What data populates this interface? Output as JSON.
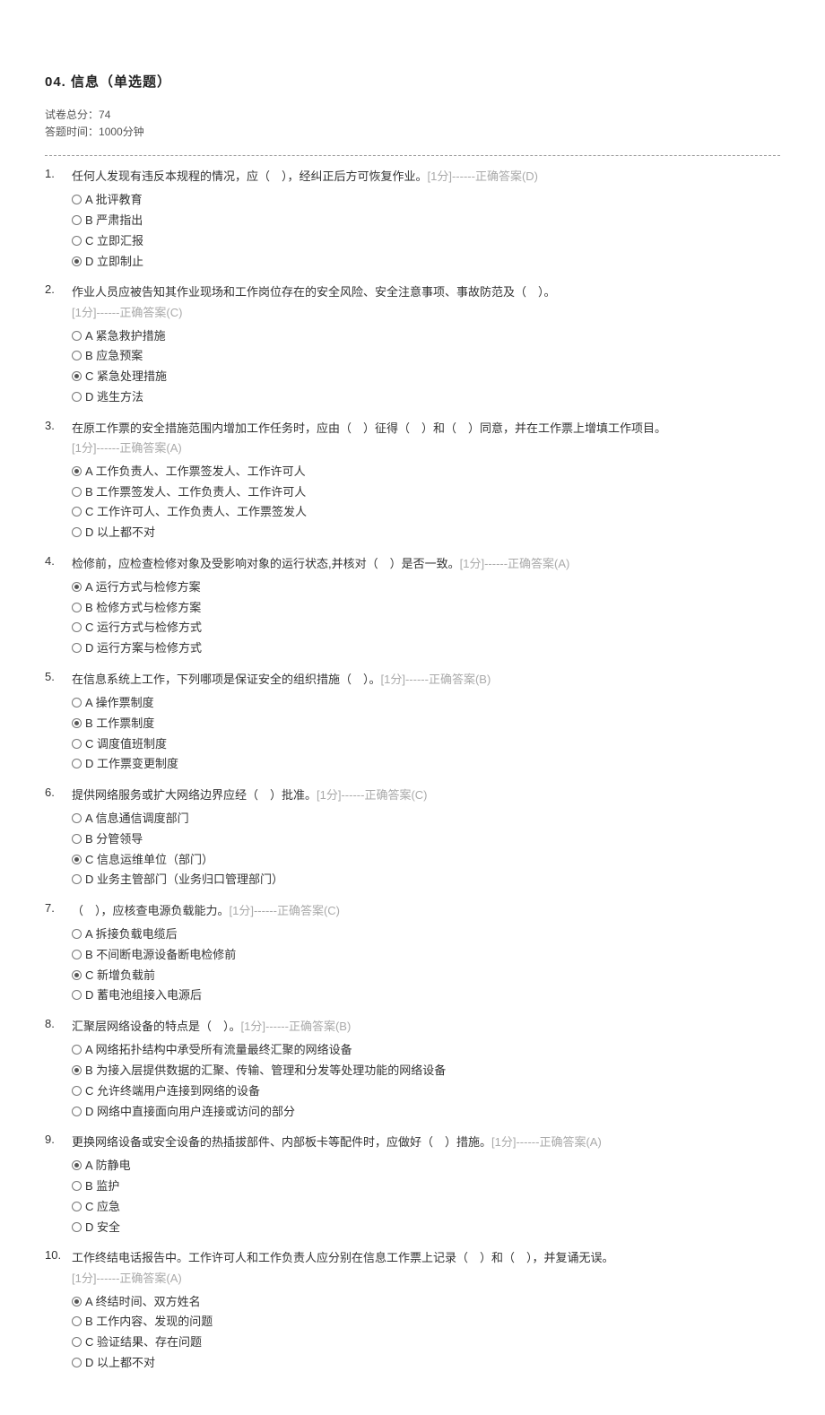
{
  "header": {
    "title": "04. 信息（单选题）",
    "total_score_label": "试卷总分：",
    "total_score": "74",
    "time_label": "答题时间：",
    "time_value": "1000分钟"
  },
  "score_prefix": "[",
  "score_unit": "分]",
  "answer_prefix": "------正确答案(",
  "answer_suffix": ")",
  "questions": [
    {
      "num": "1.",
      "stem": "任何人发现有违反本规程的情况，应（　），经纠正后方可恢复作业。",
      "score": "1",
      "answer": "D",
      "options": [
        {
          "label": "A",
          "text": "批评教育",
          "selected": false
        },
        {
          "label": "B",
          "text": "严肃指出",
          "selected": false
        },
        {
          "label": "C",
          "text": "立即汇报",
          "selected": false
        },
        {
          "label": "D",
          "text": "立即制止",
          "selected": true
        }
      ]
    },
    {
      "num": "2.",
      "stem": "作业人员应被告知其作业现场和工作岗位存在的安全风险、安全注意事项、事故防范及（　）。",
      "score": "1",
      "answer": "C",
      "options": [
        {
          "label": "A",
          "text": "紧急救护措施",
          "selected": false
        },
        {
          "label": "B",
          "text": "应急预案",
          "selected": false
        },
        {
          "label": "C",
          "text": "紧急处理措施",
          "selected": true
        },
        {
          "label": "D",
          "text": "逃生方法",
          "selected": false
        }
      ]
    },
    {
      "num": "3.",
      "stem": "在原工作票的安全措施范围内增加工作任务时，应由（　）征得（　）和（　）同意，并在工作票上增填工作项目。",
      "score": "1",
      "answer": "A",
      "options": [
        {
          "label": "A",
          "text": "工作负责人、工作票签发人、工作许可人",
          "selected": true
        },
        {
          "label": "B",
          "text": "工作票签发人、工作负责人、工作许可人",
          "selected": false
        },
        {
          "label": "C",
          "text": "工作许可人、工作负责人、工作票签发人",
          "selected": false
        },
        {
          "label": "D",
          "text": "以上都不对",
          "selected": false
        }
      ]
    },
    {
      "num": "4.",
      "stem": "检修前，应检查检修对象及受影响对象的运行状态,并核对（　）是否一致。",
      "score": "1",
      "answer": "A",
      "options": [
        {
          "label": "A",
          "text": "运行方式与检修方案",
          "selected": true
        },
        {
          "label": "B",
          "text": "检修方式与检修方案",
          "selected": false
        },
        {
          "label": "C",
          "text": "运行方式与检修方式",
          "selected": false
        },
        {
          "label": "D",
          "text": "运行方案与检修方式",
          "selected": false
        }
      ]
    },
    {
      "num": "5.",
      "stem": "在信息系统上工作，下列哪项是保证安全的组织措施（　）。",
      "score": "1",
      "answer": "B",
      "options": [
        {
          "label": "A",
          "text": "操作票制度",
          "selected": false
        },
        {
          "label": "B",
          "text": "工作票制度",
          "selected": true
        },
        {
          "label": "C",
          "text": "调度值班制度",
          "selected": false
        },
        {
          "label": "D",
          "text": "工作票变更制度",
          "selected": false
        }
      ]
    },
    {
      "num": "6.",
      "stem": "提供网络服务或扩大网络边界应经（　）批准。",
      "score": "1",
      "answer": "C",
      "options": [
        {
          "label": "A",
          "text": "信息通信调度部门",
          "selected": false
        },
        {
          "label": "B",
          "text": "分管领导",
          "selected": false
        },
        {
          "label": "C",
          "text": "信息运维单位（部门）",
          "selected": true
        },
        {
          "label": "D",
          "text": "业务主管部门（业务归口管理部门）",
          "selected": false
        }
      ]
    },
    {
      "num": "7.",
      "stem": "（　），应核查电源负载能力。",
      "score": "1",
      "answer": "C",
      "options": [
        {
          "label": "A",
          "text": "拆接负载电缆后",
          "selected": false
        },
        {
          "label": "B",
          "text": "不间断电源设备断电检修前",
          "selected": false
        },
        {
          "label": "C",
          "text": "新增负载前",
          "selected": true
        },
        {
          "label": "D",
          "text": "蓄电池组接入电源后",
          "selected": false
        }
      ]
    },
    {
      "num": "8.",
      "stem": "汇聚层网络设备的特点是（　）。",
      "score": "1",
      "answer": "B",
      "options": [
        {
          "label": "A",
          "text": "网络拓扑结构中承受所有流量最终汇聚的网络设备",
          "selected": false
        },
        {
          "label": "B",
          "text": "为接入层提供数据的汇聚、传输、管理和分发等处理功能的网络设备",
          "selected": true
        },
        {
          "label": "C",
          "text": "允许终端用户连接到网络的设备",
          "selected": false
        },
        {
          "label": "D",
          "text": "网络中直接面向用户连接或访问的部分",
          "selected": false
        }
      ]
    },
    {
      "num": "9.",
      "stem": "更换网络设备或安全设备的热插拔部件、内部板卡等配件时，应做好（　）措施。",
      "score": "1",
      "answer": "A",
      "options": [
        {
          "label": "A",
          "text": "防静电",
          "selected": true
        },
        {
          "label": "B",
          "text": "监护",
          "selected": false
        },
        {
          "label": "C",
          "text": "应急",
          "selected": false
        },
        {
          "label": "D",
          "text": "安全",
          "selected": false
        }
      ]
    },
    {
      "num": "10.",
      "stem": "工作终结电话报告中。工作许可人和工作负责人应分别在信息工作票上记录（　）和（　），并复诵无误。",
      "score": "1",
      "answer": "A",
      "options": [
        {
          "label": "A",
          "text": "终结时间、双方姓名",
          "selected": true
        },
        {
          "label": "B",
          "text": "工作内容、发现的问题",
          "selected": false
        },
        {
          "label": "C",
          "text": "验证结果、存在问题",
          "selected": false
        },
        {
          "label": "D",
          "text": "以上都不对",
          "selected": false
        }
      ]
    }
  ]
}
